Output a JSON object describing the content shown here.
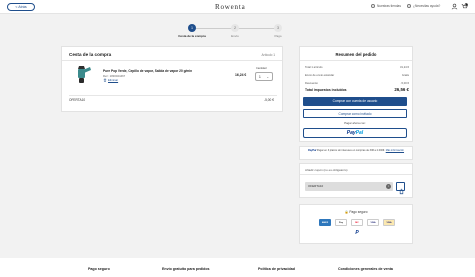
{
  "header": {
    "back_label": "< Atrás",
    "logo": "Rowenta",
    "links": [
      "Nuestras tiendas",
      "¿Necesitas ayuda?"
    ],
    "cart_count": "1"
  },
  "steps": [
    {
      "num": "1",
      "label": "Cesta de la compra"
    },
    {
      "num": "2",
      "label": "Envío"
    },
    {
      "num": "3",
      "label": "Pago"
    }
  ],
  "cart": {
    "title": "Cesta de la compra",
    "count": "Artículo 1",
    "product": {
      "name": "Pure Pop Verde, Cepillo de vapor, Salida de vapor 20 g/min",
      "ref": "Ref.: 1830024467",
      "delete": "Eliminar",
      "price": "16,24 €",
      "qty_label": "Cantidad",
      "qty": "1"
    },
    "offer_label": "OFERTA10",
    "offer_value": "-5,00 €"
  },
  "summary": {
    "title": "Resumen del pedido",
    "rows": [
      {
        "label": "Total 1 artículo",
        "value": "31,24 €"
      },
      {
        "label": "Envío de envío estándar",
        "value": "Gratis"
      },
      {
        "label": "Descuento",
        "value": "-5,00 €"
      }
    ],
    "total_label": "Total impuestos incluidos",
    "total_value": "26,56 €",
    "btn_account": "Comprar con cuenta de usuario",
    "btn_guest": "Comprar como invitado",
    "pay_with": "Pagar ahora con:",
    "paypal_a": "Pay",
    "paypal_b": "Pal"
  },
  "paypal_note": {
    "brand": "PayPal",
    "text": "Pagar en 3 plazos sin intereses en compras de 30€ a 2.000€.",
    "link": "Más información"
  },
  "coupon": {
    "title": "Añadir cupón (no es obligatorio)",
    "value": "OFERTA10"
  },
  "secure": {
    "title": "Pago seguro",
    "cards": [
      "AMEX",
      "Pay",
      "MC",
      "VISA",
      "VISA"
    ],
    "paypal_icon": "P"
  },
  "footer": [
    "Pago seguro",
    "Envío gratuito para pedidos",
    "Política de privacidad",
    "Condiciones generales de venta"
  ],
  "colors": {
    "primary": "#1f4e8c",
    "background": "#f2f2f2"
  }
}
